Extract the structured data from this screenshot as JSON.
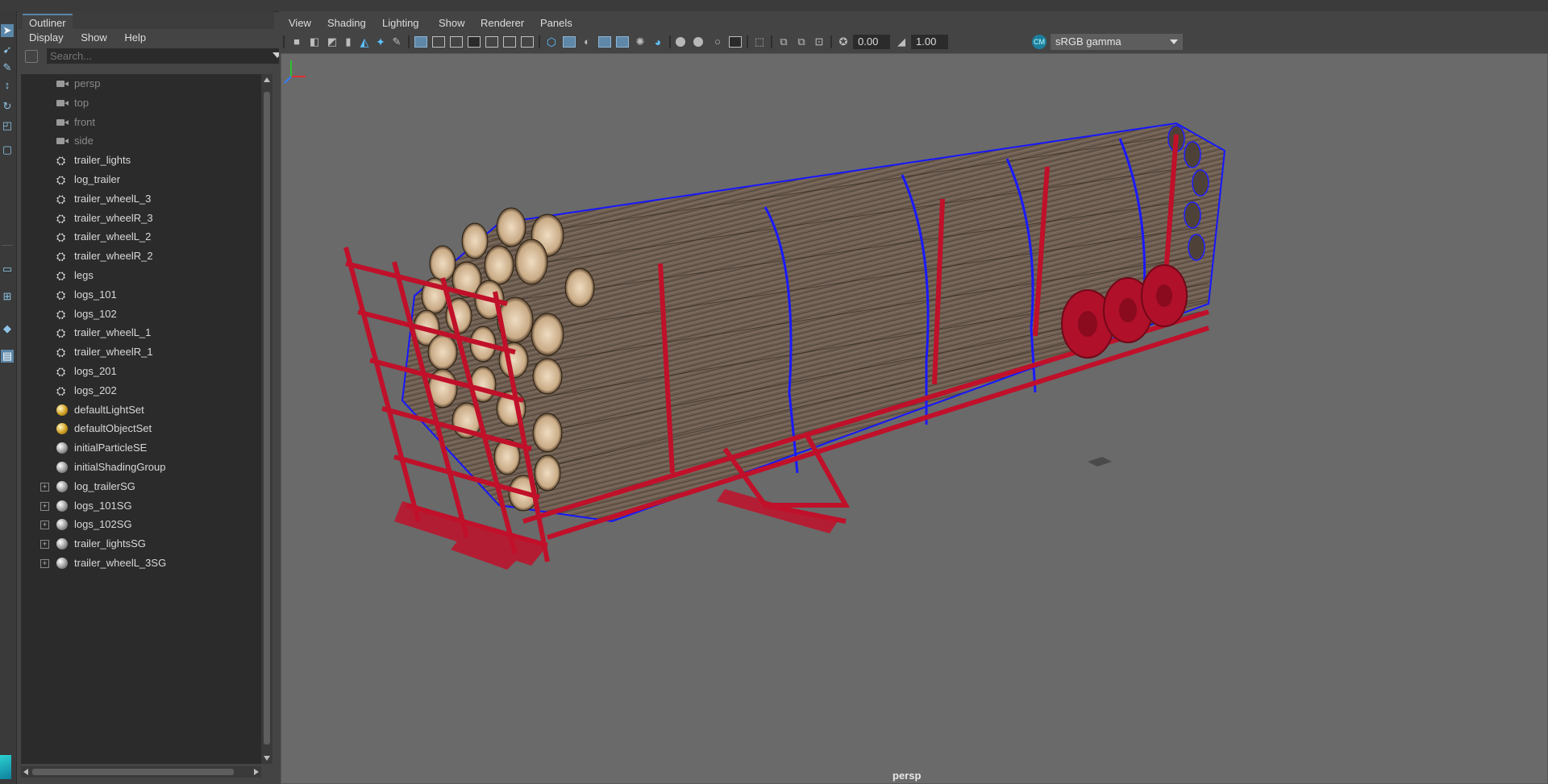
{
  "outliner": {
    "tab_label": "Outliner",
    "menu": [
      "Display",
      "Show",
      "Help"
    ],
    "search_placeholder": "Search...",
    "items": [
      {
        "label": "persp",
        "icon": "camera-icon",
        "dim": true
      },
      {
        "label": "top",
        "icon": "camera-icon",
        "dim": true
      },
      {
        "label": "front",
        "icon": "camera-icon",
        "dim": true
      },
      {
        "label": "side",
        "icon": "camera-icon",
        "dim": true
      },
      {
        "label": "trailer_lights",
        "icon": "mesh-transform-icon"
      },
      {
        "label": "log_trailer",
        "icon": "mesh-transform-icon"
      },
      {
        "label": "trailer_wheelL_3",
        "icon": "mesh-transform-icon"
      },
      {
        "label": "trailer_wheelR_3",
        "icon": "mesh-transform-icon"
      },
      {
        "label": "trailer_wheelL_2",
        "icon": "mesh-transform-icon"
      },
      {
        "label": "trailer_wheelR_2",
        "icon": "mesh-transform-icon"
      },
      {
        "label": "legs",
        "icon": "mesh-transform-icon"
      },
      {
        "label": "logs_101",
        "icon": "mesh-transform-icon"
      },
      {
        "label": "logs_102",
        "icon": "mesh-transform-icon"
      },
      {
        "label": "trailer_wheelL_1",
        "icon": "mesh-transform-icon"
      },
      {
        "label": "trailer_wheelR_1",
        "icon": "mesh-transform-icon"
      },
      {
        "label": "logs_201",
        "icon": "mesh-transform-icon"
      },
      {
        "label": "logs_202",
        "icon": "mesh-transform-icon"
      },
      {
        "label": "defaultLightSet",
        "icon": "light-set-icon"
      },
      {
        "label": "defaultObjectSet",
        "icon": "object-set-icon"
      },
      {
        "label": "initialParticleSE",
        "icon": "shading-group-icon"
      },
      {
        "label": "initialShadingGroup",
        "icon": "shading-group-icon"
      },
      {
        "label": "log_trailerSG",
        "icon": "shading-group-icon",
        "expandable": true
      },
      {
        "label": "logs_101SG",
        "icon": "shading-group-icon",
        "expandable": true
      },
      {
        "label": "logs_102SG",
        "icon": "shading-group-icon",
        "expandable": true
      },
      {
        "label": "trailer_lightsSG",
        "icon": "shading-group-icon",
        "expandable": true
      },
      {
        "label": "trailer_wheelL_3SG",
        "icon": "shading-group-icon",
        "expandable": true
      }
    ]
  },
  "viewport": {
    "menu": [
      "View",
      "Shading",
      "Lighting",
      "Show",
      "Renderer",
      "Panels"
    ],
    "exposure": "0.00",
    "gamma": "1.00",
    "color_space": "sRGB gamma",
    "camera_label": "persp"
  },
  "colors": {
    "trailer_wireframe": "#c0102a",
    "logs_wireframe_selected": "#1a1aff",
    "viewport_bg": "#6a6a6a",
    "accent": "#5a86a8"
  }
}
